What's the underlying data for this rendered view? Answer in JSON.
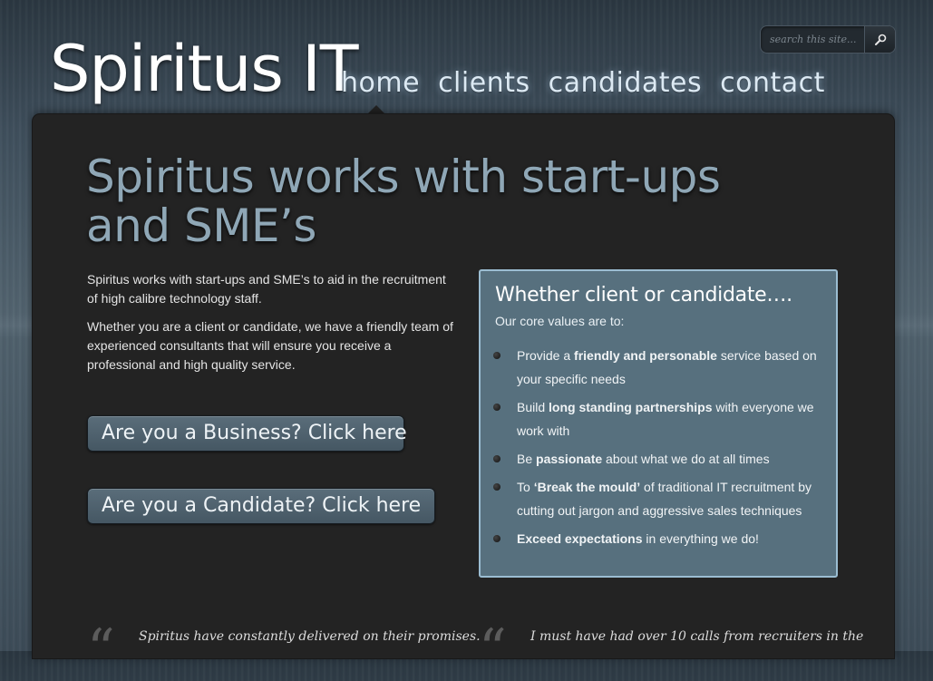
{
  "header": {
    "logo": "Spiritus IT",
    "nav": [
      "home",
      "clients",
      "candidates",
      "contact"
    ],
    "search": {
      "placeholder": "search this site...",
      "icon": "search-icon"
    }
  },
  "main": {
    "headline": "Spiritus works with start-ups and SME’s",
    "intro": [
      "Spiritus works with start-ups and SME’s to aid in the recruitment of high calibre technology staff.",
      "Whether you are a client or candidate, we have a friendly team of experienced consultants that will ensure you receive a professional and high quality service."
    ],
    "cta_business": "Are you a Business? Click here",
    "cta_candidate": "Are you a Candidate? Click here"
  },
  "values_box": {
    "title": "Whether client or candidate….",
    "subtitle": "Our core values are to:",
    "items": [
      {
        "before": "Provide a ",
        "bold": "friendly and personable",
        "after": " service based on your specific needs"
      },
      {
        "before": "Build ",
        "bold": "long standing partnerships",
        "after": " with everyone we work with"
      },
      {
        "before": "Be ",
        "bold": "passionate",
        "after": " about what we do at all times"
      },
      {
        "before": "To ",
        "bold": "‘Break the mould’",
        "after": " of traditional IT recruitment by cutting out jargon and aggressive sales techniques"
      },
      {
        "before": "",
        "bold": "Exceed expectations",
        "after": " in everything we do!"
      }
    ]
  },
  "testimonials": [
    {
      "text": "Spiritus have constantly delivered on their promises."
    },
    {
      "text": "I must have had over 10 calls from recruiters in the"
    }
  ],
  "colors": {
    "headline": "#8fa7b6",
    "values_box_bg": "#57707e",
    "values_box_border": "#9bbdd2",
    "panel_bg": "#232323"
  }
}
